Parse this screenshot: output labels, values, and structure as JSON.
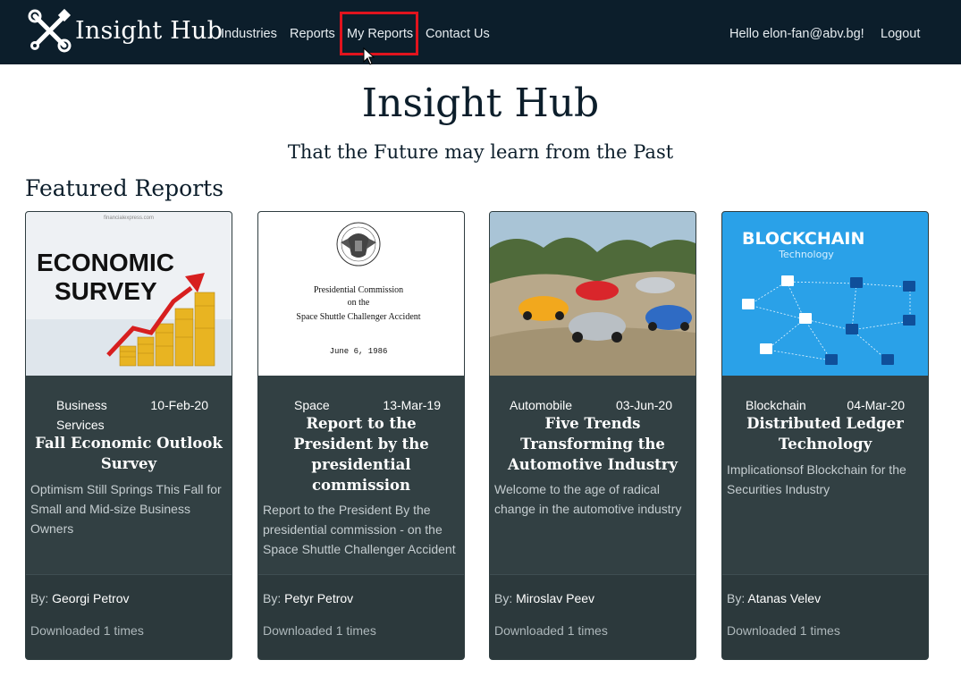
{
  "navbar": {
    "brand": "Insight Hub",
    "links": [
      "Industries",
      "Reports",
      "My Reports",
      "Contact Us"
    ],
    "greeting": "Hello elon-fan@abv.bg!",
    "logout": "Logout",
    "highlight_color": "#e0141e",
    "background": "#0c1e2b"
  },
  "hero": {
    "title": "Insight Hub",
    "subtitle": "That the Future may learn from the Past"
  },
  "featured": {
    "heading": "Featured Reports",
    "cards": [
      {
        "image_text": [
          "ECONOMIC",
          "SURVEY",
          "financialexpress.com"
        ],
        "industry": "Business Services",
        "date": "10-Feb-20",
        "title": "Fall Economic Outlook Survey",
        "description": "Optimism Still Springs This Fall for Small and Mid-size Business Owners",
        "author_prefix": "By:",
        "author": "Georgi Petrov",
        "downloads": "Downloaded 1 times"
      },
      {
        "image_text": [
          "Presidential Commission",
          "on the",
          "Space Shuttle Challenger Accident",
          "June 6, 1986"
        ],
        "industry": "Space",
        "date": "13-Mar-19",
        "title": "Report to the President by the presidential commission",
        "description": "Report to the President By the presidential commission - on the Space Shuttle Challenger Accident",
        "author_prefix": "By:",
        "author": "Petyr Petrov",
        "downloads": "Downloaded 1 times"
      },
      {
        "image_text": [],
        "industry": "Automobile",
        "date": "03-Jun-20",
        "title": "Five Trends Transforming the Automotive Industry",
        "description": "Welcome to the age of radical change in the automotive industry",
        "author_prefix": "By:",
        "author": "Miroslav Peev",
        "downloads": "Downloaded 1 times"
      },
      {
        "image_text": [
          "BLOCKCHAIN",
          "Technology"
        ],
        "industry": "Blockchain",
        "date": "04-Mar-20",
        "title": "Distributed Ledger Technology",
        "description": "Implicationsof Blockchain for the Securities Industry",
        "author_prefix": "By:",
        "author": "Atanas Velev",
        "downloads": "Downloaded 1 times"
      }
    ]
  }
}
